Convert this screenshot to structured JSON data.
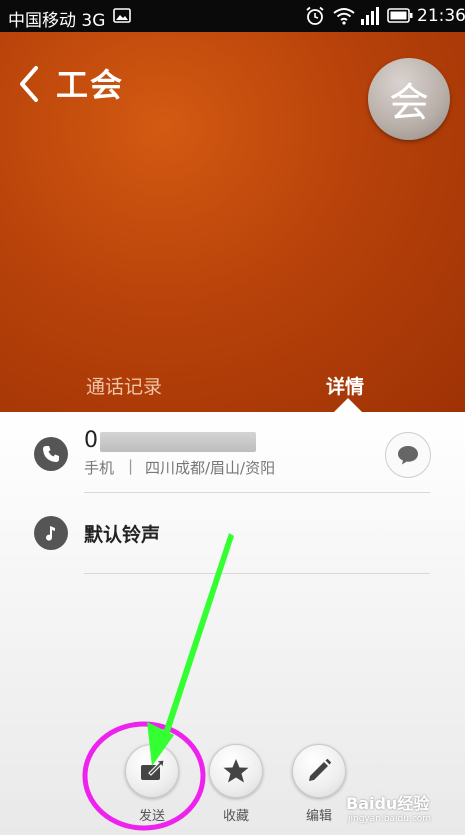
{
  "status_bar": {
    "carrier": "中国移动 3G",
    "time": "21:36",
    "icons": [
      "image-icon",
      "alarm-icon",
      "wifi-icon",
      "signal-icon",
      "battery-icon"
    ]
  },
  "header": {
    "contact_name": "工会",
    "avatar_char": "会",
    "background_color": "#b8420a",
    "tabs": [
      {
        "label": "通话记录",
        "active": false
      },
      {
        "label": "详情",
        "active": true
      }
    ]
  },
  "details": {
    "phone": {
      "number_visible": "0",
      "type": "手机",
      "separator": "|",
      "location": "四川成都/眉山/资阳"
    },
    "ringtone": {
      "label": "默认铃声"
    }
  },
  "toolbar": {
    "send_label": "发送",
    "favorite_label": "收藏",
    "edit_label": "编辑"
  },
  "annotation": {
    "arrow_color": "#33ff33",
    "circle_color": "#ee22ee"
  },
  "watermark": {
    "text": "Baidu经验",
    "sub": "jingyan.baidu.com"
  }
}
